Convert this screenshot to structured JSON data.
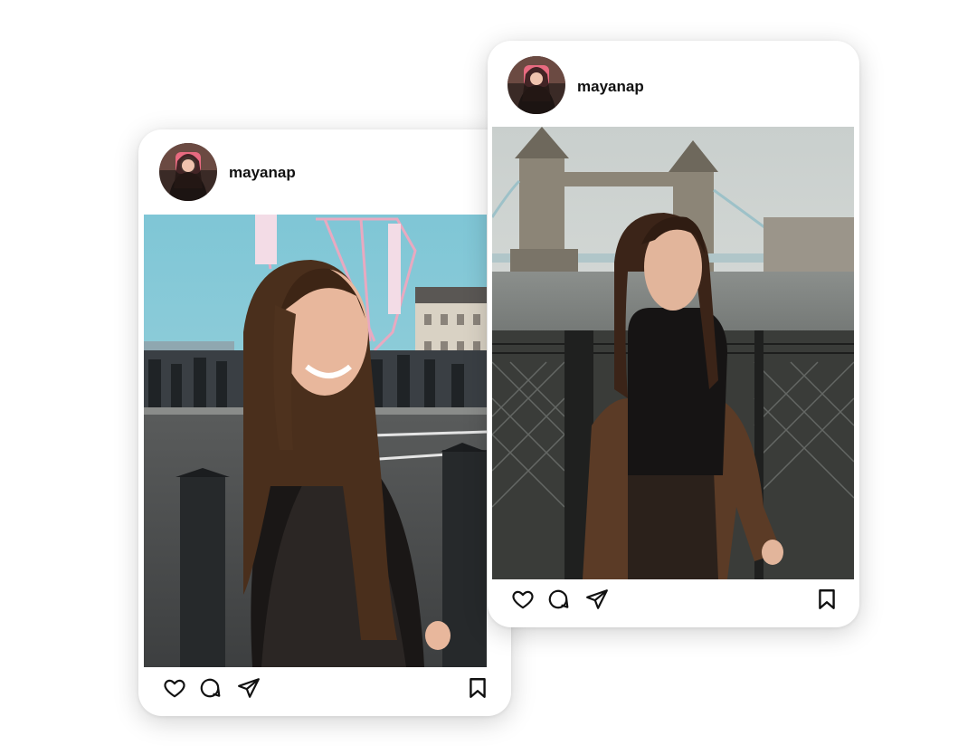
{
  "posts": [
    {
      "username": "mayanap",
      "avatar_icon": "profile-photo",
      "photo_description_icon": "photo-london-eye",
      "actions": [
        "heart-icon",
        "comment-icon",
        "share-icon",
        "bookmark-icon"
      ]
    },
    {
      "username": "mayanap",
      "avatar_icon": "profile-photo",
      "photo_description_icon": "photo-tower-bridge",
      "actions": [
        "heart-icon",
        "comment-icon",
        "share-icon",
        "bookmark-icon"
      ]
    }
  ],
  "colors": {
    "card": "#ffffff",
    "text": "#111111",
    "shadow": "#00000030"
  }
}
